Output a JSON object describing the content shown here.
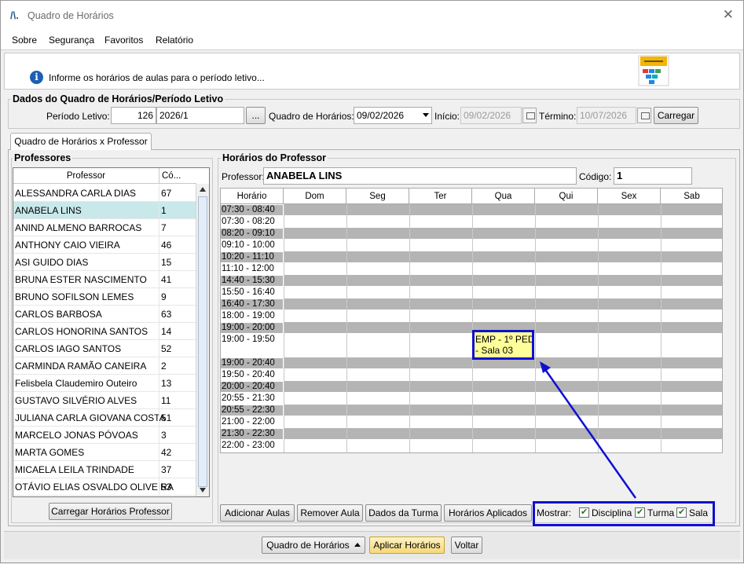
{
  "window": {
    "title": "Quadro de Horários"
  },
  "menu": [
    {
      "label": "Sobre"
    },
    {
      "label": "Segurança"
    },
    {
      "label": "Favoritos"
    },
    {
      "label": "Relatório"
    }
  ],
  "info": {
    "text": "Informe os horários de aulas para o período letivo..."
  },
  "periodo": {
    "legend": "Dados do Quadro de Horários/Período Letivo",
    "periodo_label": "Período Letivo:",
    "periodo_code": "126",
    "periodo_value": "2026/1",
    "ellipsis": "...",
    "quadro_label": "Quadro de Horários:",
    "quadro_value": "09/02/2026",
    "inicio_label": "Início:",
    "inicio_value": "09/02/2026",
    "termino_label": "Término:",
    "termino_value": "10/07/2026",
    "carregar": "Carregar"
  },
  "tab": {
    "label": "Quadro de Horários x Professor"
  },
  "professores": {
    "legend": "Professores",
    "col_professor": "Professor",
    "col_codigo": "Có...",
    "rows": [
      {
        "name": "ALESSANDRA CARLA DIAS",
        "code": "67"
      },
      {
        "name": "ANABELA LINS",
        "code": "1"
      },
      {
        "name": "ANIND ALMENO BARROCAS",
        "code": "7"
      },
      {
        "name": "ANTHONY CAIO VIEIRA",
        "code": "46"
      },
      {
        "name": "ASI GUIDO DIAS",
        "code": "15"
      },
      {
        "name": "BRUNA ESTER NASCIMENTO",
        "code": "41"
      },
      {
        "name": "BRUNO SOFILSON LEMES",
        "code": "9"
      },
      {
        "name": "CARLOS BARBOSA",
        "code": "63"
      },
      {
        "name": "CARLOS HONORINA SANTOS",
        "code": "14"
      },
      {
        "name": "CARLOS IAGO SANTOS",
        "code": "52"
      },
      {
        "name": "CARMINDA RAMÃO CANEIRA",
        "code": "2"
      },
      {
        "name": "Felisbela Claudemiro Outeiro",
        "code": "13"
      },
      {
        "name": "GUSTAVO SILVÉRIO ALVES",
        "code": "11"
      },
      {
        "name": "JULIANA CARLA GIOVANA COSTA",
        "code": "51"
      },
      {
        "name": "MARCELO JONAS PÓVOAS",
        "code": "3"
      },
      {
        "name": "MARTA GOMES",
        "code": "42"
      },
      {
        "name": "MICAELA LEILA TRINDADE",
        "code": "37"
      },
      {
        "name": "OTÁVIO ELIAS OSVALDO OLIVEIRA",
        "code": "53"
      }
    ],
    "carregar_button": "Carregar Horários Professor"
  },
  "horarios": {
    "legend": "Horários do Professor",
    "professor_label": "Professor:",
    "professor_value": "ANABELA LINS",
    "codigo_label": "Código:",
    "codigo_value": "1",
    "columns": [
      "Horário",
      "Dom",
      "Seg",
      "Ter",
      "Qua",
      "Qui",
      "Sex",
      "Sab"
    ],
    "slots": [
      "07:30 - 08:40",
      "07:30 - 08:20",
      "08:20 - 09:10",
      "09:10 - 10:00",
      "10:20 - 11:10",
      "11:10 - 12:00",
      "14:40 - 15:30",
      "15:50 - 16:40",
      "16:40 - 17:30",
      "18:00 - 19:00",
      "19:00 - 20:00",
      "19:00 - 19:50",
      "19:00 - 20:40",
      "19:50 - 20:40",
      "20:00 - 20:40",
      "20:55 - 21:30",
      "20:55 - 22:30",
      "21:00 - 22:00",
      "21:30 - 22:30",
      "22:00 - 23:00"
    ],
    "event": {
      "line1": "EMP - 1º PED",
      "line2": "- Sala 03"
    }
  },
  "actions": {
    "adicionar": "Adicionar Aulas",
    "remover": "Remover Aula",
    "dados_turma": "Dados da Turma",
    "horarios_aplicados": "Horários Aplicados",
    "mostrar_label": "Mostrar:",
    "disciplina": "Disciplina",
    "turma": "Turma",
    "sala": "Sala"
  },
  "footer": {
    "quadro": "Quadro de Horários",
    "aplicar": "Aplicar Horários",
    "voltar": "Voltar"
  },
  "colors": {
    "selected_row": "#c9e8ea",
    "highlight": "#1010d0",
    "event_bg": "#ffff99",
    "grey_row": "#b4b4b4"
  }
}
